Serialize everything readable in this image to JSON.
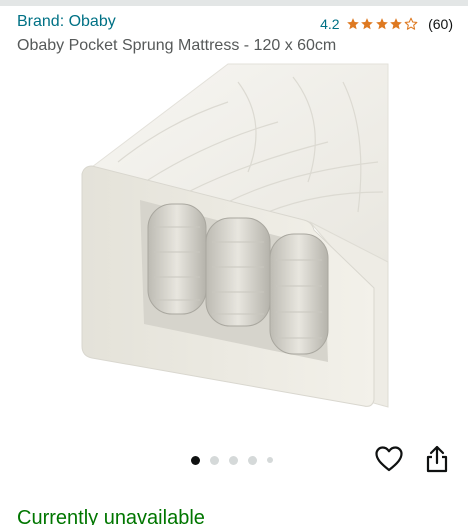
{
  "brand": {
    "label": "Brand: Obaby"
  },
  "rating": {
    "value": "4.2",
    "stars_filled": 4,
    "stars_total": 5,
    "count": "(60)",
    "star_color": "#de7921"
  },
  "product": {
    "title": "Obaby Pocket Sprung Mattress - 120 x 60cm"
  },
  "gallery": {
    "image_count": 5,
    "active_index": 0
  },
  "icons": {
    "wishlist": "heart-outline-icon",
    "share": "share-icon"
  },
  "availability": {
    "text": "Currently unavailable",
    "color": "#007600"
  },
  "colors": {
    "link": "#007185",
    "text": "#0f1111",
    "muted": "#565959"
  }
}
